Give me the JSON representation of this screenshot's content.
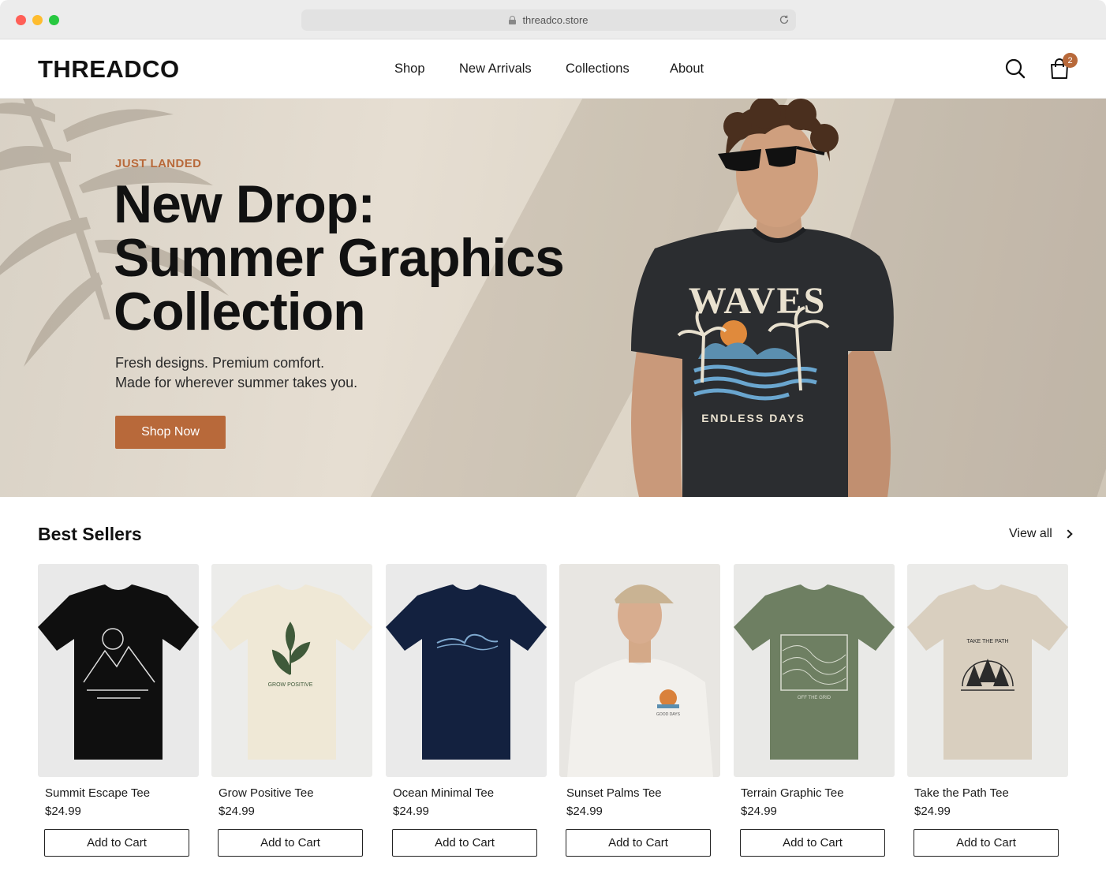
{
  "browser": {
    "url": "threadco.store",
    "traffic_lights": [
      "#ff5f57",
      "#febc2e",
      "#28c840"
    ]
  },
  "header": {
    "logo": "THREADCO",
    "nav": [
      "Shop",
      "New Arrivals",
      "Collections",
      "About"
    ],
    "cart_count": "2",
    "icons": [
      "search-icon",
      "cart-icon"
    ]
  },
  "hero": {
    "eyebrow": "JUST LANDED",
    "headline_lines": [
      "New Drop:",
      "Summer Graphics",
      "Collection"
    ],
    "subcopy_lines": [
      "Fresh designs. Premium comfort.",
      "Made for wherever summer takes you."
    ],
    "cta_label": "Shop Now",
    "shirt_print_top": "WAVES",
    "shirt_print_bottom": "ENDLESS DAYS"
  },
  "best_sellers": {
    "title": "Best Sellers",
    "view_all": "View all",
    "products": [
      {
        "name": "Summit Escape Tee",
        "price": "$24.99",
        "button": "Add to Cart",
        "shirt_color": "#0f0f0f",
        "bg": "#e9e9e9",
        "print_color": "#dddddd"
      },
      {
        "name": "Grow Positive Tee",
        "price": "$24.99",
        "button": "Add to Cart",
        "shirt_color": "#efe8d6",
        "bg": "#ececea",
        "print_color": "#3f5a3a",
        "print_text": "GROW POSITIVE"
      },
      {
        "name": "Ocean Minimal Tee",
        "price": "$24.99",
        "button": "Add to Cart",
        "shirt_color": "#13213f",
        "bg": "#eaeaea",
        "print_color": "#7fa9cf"
      },
      {
        "name": "Sunset Palms Tee",
        "price": "$24.99",
        "button": "Add to Cart",
        "shirt_color": "#f2f0ec",
        "bg": "#e8e6e2",
        "print_color": "#d9813b",
        "print_text": "GOOD DAYS"
      },
      {
        "name": "Terrain Graphic Tee",
        "price": "$24.99",
        "button": "Add to Cart",
        "shirt_color": "#6e7f62",
        "bg": "#e9e9e7",
        "print_color": "#d8dccf",
        "print_text": "OFF THE GRID"
      },
      {
        "name": "Take the Path Tee",
        "price": "$24.99",
        "button": "Add to Cart",
        "shirt_color": "#d9cfbf",
        "bg": "#ebebe9",
        "print_color": "#2b2b2b",
        "print_text": "TAKE THE PATH"
      }
    ]
  }
}
